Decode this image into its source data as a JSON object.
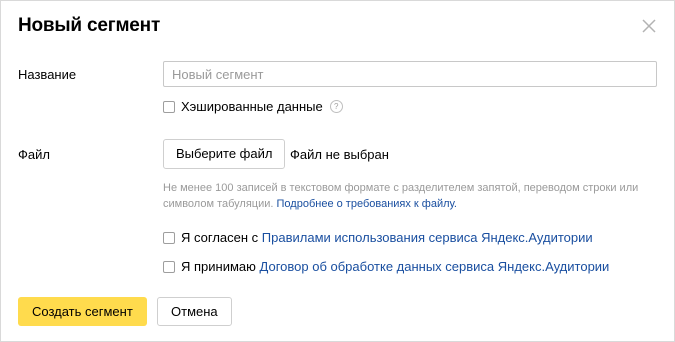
{
  "dialog": {
    "title": "Новый сегмент",
    "close_icon": "close-icon"
  },
  "name_field": {
    "label": "Название",
    "placeholder": "Новый сегмент",
    "value": ""
  },
  "hashed_option": {
    "label": "Хэшированные данные",
    "checked": false,
    "help_icon": "question-circle-icon",
    "help_glyph": "?"
  },
  "file_field": {
    "label": "Файл",
    "button_label": "Выберите файл",
    "status": "Файл не выбран",
    "hint_text": "Не менее 100 записей в текстовом формате с разделителем запятой, переводом строки или символом табуляции. ",
    "hint_link": "Подробнее о требованиях к файлу."
  },
  "agreements": {
    "terms": {
      "prefix": "Я согласен с ",
      "link": "Правилами использования сервиса Яндекс.Аудитории",
      "checked": false
    },
    "data_processing": {
      "prefix": "Я принимаю ",
      "link": "Договор об обработке данных сервиса Яндекс.Аудитории",
      "checked": false
    }
  },
  "actions": {
    "create_label": "Создать сегмент",
    "cancel_label": "Отмена"
  },
  "colors": {
    "primary_button": "#ffdb4d",
    "link": "#1a4fa0",
    "hint": "#9a9a9a"
  }
}
